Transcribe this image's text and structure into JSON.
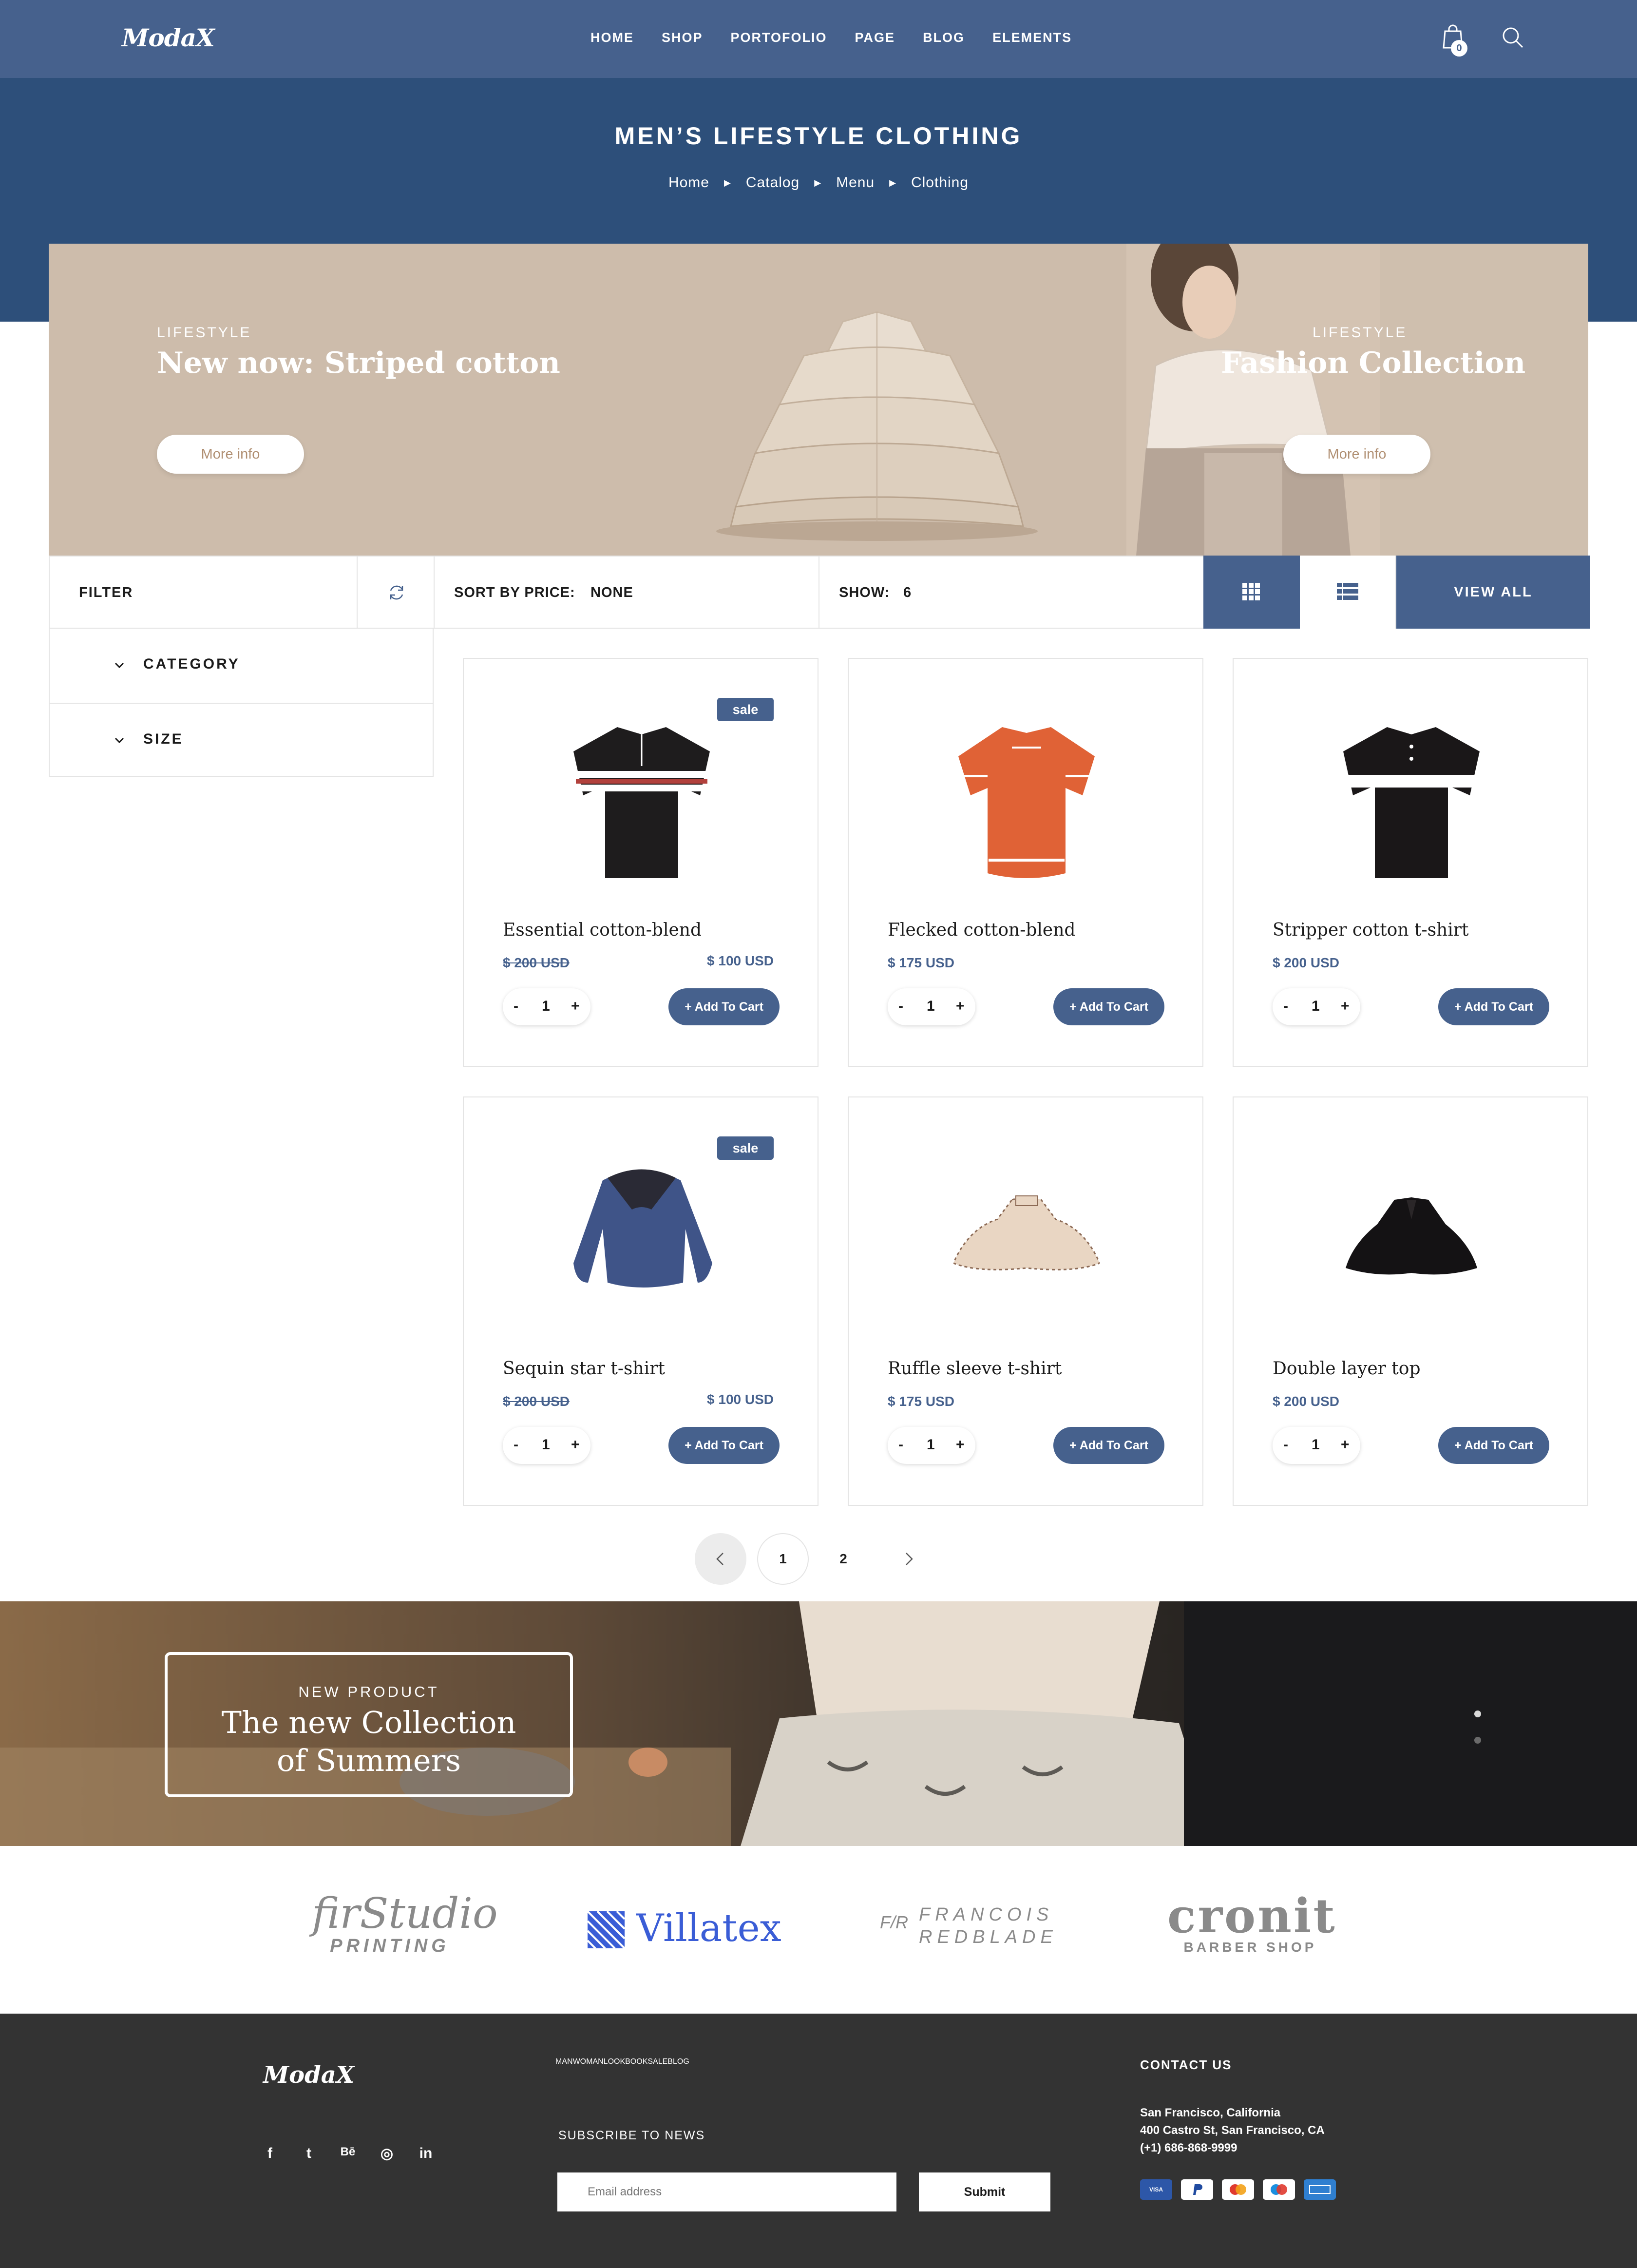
{
  "header": {
    "logo": "ModaX",
    "nav": [
      "HOME",
      "SHOP",
      "PORTOFOLIO",
      "PAGE",
      "BLOG",
      "ELEMENTS"
    ],
    "cart_count": "0",
    "icons": [
      "shopping-bag-icon",
      "search-icon"
    ]
  },
  "hero": {
    "title": "MEN’S LIFESTYLE CLOTHING",
    "breadcrumb": [
      "Home",
      "Catalog",
      "Menu",
      "Clothing"
    ]
  },
  "banners": [
    {
      "kicker": "LIFESTYLE",
      "title": "New now: Striped cotton",
      "button": "More info"
    },
    {
      "kicker": "LIFESTYLE",
      "title": "Fashion Collection",
      "button": "More info"
    }
  ],
  "toolbar": {
    "filter": "FILTER",
    "sort_label": "SORT BY PRICE:",
    "sort_value": "NONE",
    "show_label": "SHOW:",
    "show_value": "6",
    "view_all": "VIEW ALL"
  },
  "sidebar": {
    "items": [
      "CATEGORY",
      "SIZE"
    ]
  },
  "products": [
    {
      "name": "Essential cotton-blend",
      "badge": "sale",
      "old_price": "$ 200 USD",
      "price": "$ 100 USD",
      "qty": "1",
      "button": "+ Add To Cart"
    },
    {
      "name": "Flecked cotton-blend",
      "badge": "",
      "old_price": "",
      "price": "$ 175 USD",
      "qty": "1",
      "button": "+ Add To Cart"
    },
    {
      "name": "Stripper cotton t-shirt",
      "badge": "",
      "old_price": "",
      "price": "$ 200 USD",
      "qty": "1",
      "button": "+ Add To Cart"
    },
    {
      "name": "Sequin star t-shirt",
      "badge": "sale",
      "old_price": "$ 200 USD",
      "price": "$ 100 USD",
      "qty": "1",
      "button": "+ Add To Cart"
    },
    {
      "name": "Ruffle sleeve t-shirt",
      "badge": "",
      "old_price": "",
      "price": "$ 175 USD",
      "qty": "1",
      "button": "+ Add To Cart"
    },
    {
      "name": "Double layer top",
      "badge": "",
      "old_price": "",
      "price": "$ 200 USD",
      "qty": "1",
      "button": "+ Add To Cart"
    }
  ],
  "pagination": {
    "pages": [
      "1",
      "2"
    ],
    "current": "1"
  },
  "promo": {
    "kicker": "NEW PRODUCT",
    "title_line1": "The new Collection",
    "title_line2": "of Summers"
  },
  "partners": {
    "firstudio": {
      "main": "firStudio",
      "sub": "PRINTING"
    },
    "villatex": {
      "main": "Villatex"
    },
    "francois": {
      "mark": "F/R",
      "line1": "FRANCOIS",
      "line2": "REDBLADE"
    },
    "cronit": {
      "main": "cronit",
      "sub": "BARBER SHOP"
    }
  },
  "footer": {
    "logo": "ModaX",
    "social": [
      "f",
      "t",
      "Bē",
      "◎",
      "in"
    ],
    "nav": [
      "MAN",
      "WOMAN",
      "LOOKBOOK",
      "SALE",
      "BLOG"
    ],
    "subscribe_label": "SUBSCRIBE TO NEWS",
    "email_placeholder": "Email address",
    "submit": "Submit",
    "contact_title": "CONTACT US",
    "contact_lines": [
      "San Francisco, California",
      "400 Castro St, San Francisco, CA",
      "(+1) 686-868-9999"
    ],
    "payment_cards": [
      "VISA",
      "PayPal",
      "Mastercard",
      "Maestro",
      "AmEx"
    ]
  },
  "colors": {
    "accent": "#46618d",
    "hero": "#2d4f7a",
    "banner": "#cdbcab",
    "footer": "#333333"
  }
}
